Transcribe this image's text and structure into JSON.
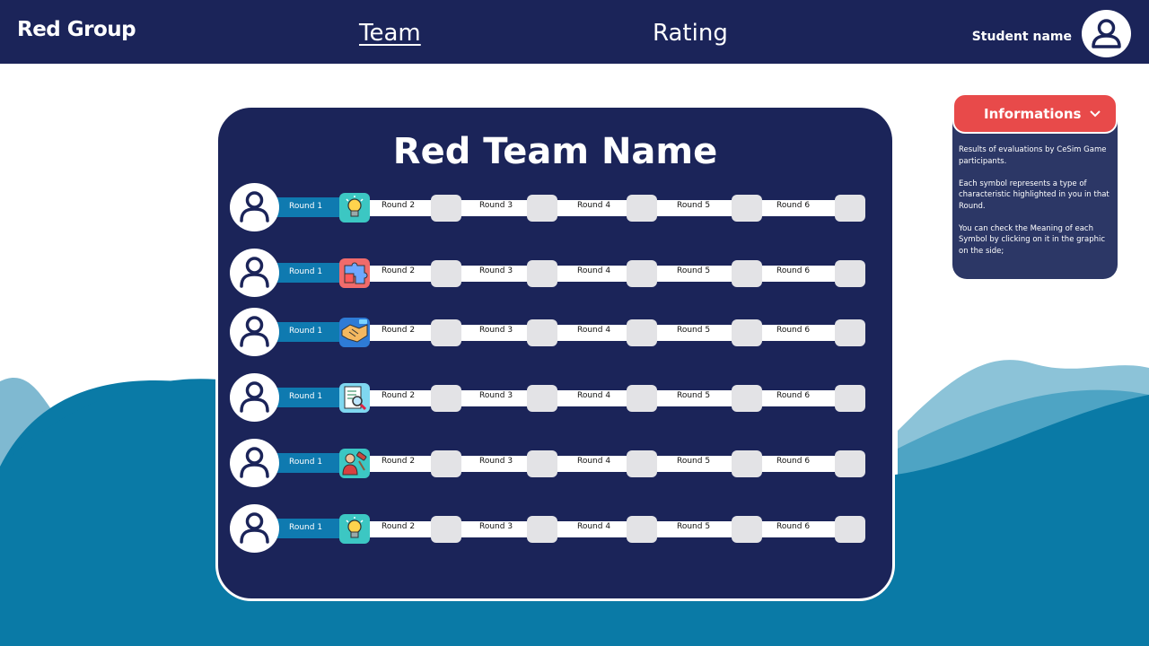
{
  "header": {
    "brand": "Red Group",
    "nav": {
      "team": "Team",
      "rating": "Rating"
    },
    "student_name": "Student name"
  },
  "card": {
    "title": "Red Team Name",
    "round1_label": "Round 1",
    "round_labels": [
      "Round 2",
      "Round 3",
      "Round 4",
      "Round 5",
      "Round 6"
    ],
    "members": [
      {
        "symbol": "lightbulb-icon"
      },
      {
        "symbol": "puzzle-icon"
      },
      {
        "symbol": "handshake-icon"
      },
      {
        "symbol": "document-search-icon"
      },
      {
        "symbol": "judge-gavel-icon"
      },
      {
        "symbol": "lightbulb-icon"
      }
    ]
  },
  "info": {
    "title": "Informations",
    "text": "Results of evaluations by CeSim Game participants.\n\nEach symbol represents a type of characteristic highlighted in you in that Round.\n\n  You can check the Meaning of each Symbol by clicking on it in the graphic on the side;"
  },
  "colors": {
    "navy": "#1b2459",
    "accent_red": "#e84a4a",
    "round_blue": "#0f7ab0",
    "wave_blue": "#0a7aa6"
  }
}
